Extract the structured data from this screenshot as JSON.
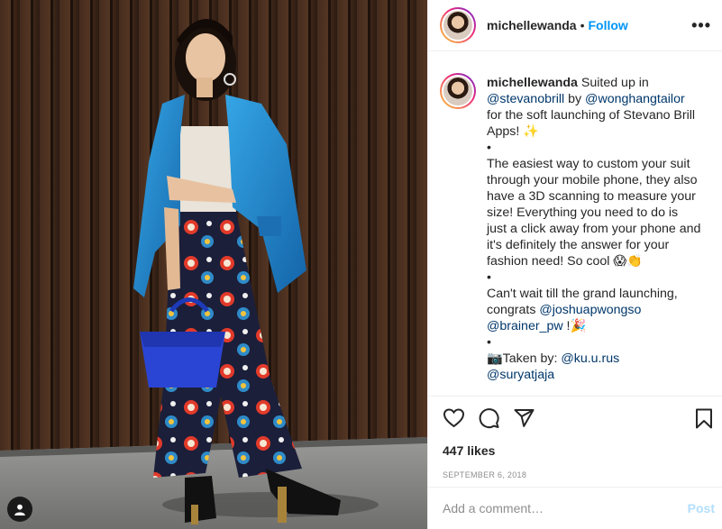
{
  "post": {
    "username": "michellewanda",
    "dot": "•",
    "follow_label": "Follow",
    "more_label": "•••",
    "caption": {
      "username": "michellewanda",
      "line1_text": " Suited up in ",
      "mention1": "@stevanobrill",
      "by_text": " by ",
      "mention2": "@wonghangtailor",
      "line1_tail": " for the soft launching of Stevano Brill Apps! ✨",
      "bullet": "•",
      "paragraph2": "The easiest way to custom your suit through your mobile phone, they also have a 3D scanning to measure your size! Everything you need to do is just a click away from your phone and it's definitely the answer for your fashion need! So cool 😱👏",
      "paragraph3_text": "Can't wait till the grand launching, congrats ",
      "mention3": "@joshuapwongso",
      "mention4": "@brainer_pw",
      "paragraph3_tail": " !🎉",
      "taken_text": "📷Taken by: ",
      "mention5": "@ku.u.rus",
      "mention6": "@suryatjaja"
    },
    "likes": "447 likes",
    "date": "SEPTEMBER 6, 2018",
    "comment_placeholder": "Add a comment…",
    "post_label": "Post"
  },
  "icons": {
    "like": "heart-icon",
    "comment": "comment-icon",
    "share": "share-icon",
    "save": "bookmark-icon",
    "user_tag": "user-icon"
  },
  "colors": {
    "link": "#0095f6",
    "mention": "#00376b",
    "muted": "#8e8e8e",
    "post_disabled": "#b2dffc"
  }
}
